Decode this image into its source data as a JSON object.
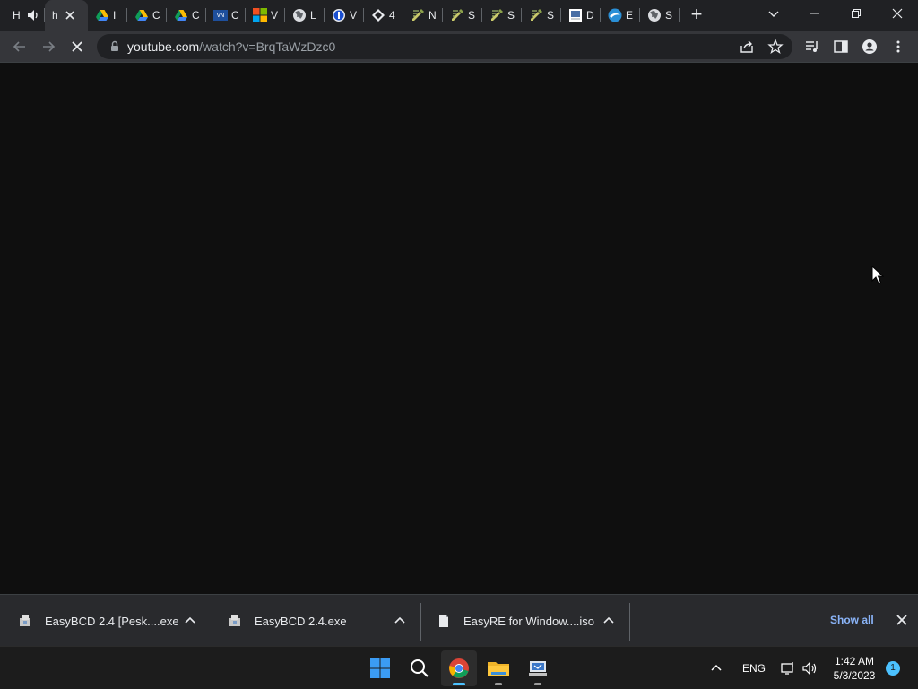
{
  "browser": {
    "tabs": [
      {
        "title": "H",
        "favicon": "text-h",
        "audio": true
      },
      {
        "title": "h",
        "favicon": "text-h-active",
        "active": true
      },
      {
        "title": "I",
        "favicon": "google-drive-icon"
      },
      {
        "title": "C",
        "favicon": "google-drive-icon"
      },
      {
        "title": "C",
        "favicon": "google-drive-icon"
      },
      {
        "title": "C",
        "favicon": "vn-badge-icon"
      },
      {
        "title": "V",
        "favicon": "microsoft-icon"
      },
      {
        "title": "L",
        "favicon": "globe-icon"
      },
      {
        "title": "V",
        "favicon": "blue-circle-icon"
      },
      {
        "title": "4",
        "favicon": "diamond-icon"
      },
      {
        "title": "N",
        "favicon": "edit-icon"
      },
      {
        "title": "S",
        "favicon": "edit-icon"
      },
      {
        "title": "S",
        "favicon": "edit-icon"
      },
      {
        "title": "S",
        "favicon": "edit-icon"
      },
      {
        "title": "D",
        "favicon": "doc-icon"
      },
      {
        "title": "E",
        "favicon": "wave-icon"
      },
      {
        "title": "S",
        "favicon": "globe-icon"
      }
    ],
    "new_tab_label": "+",
    "url_host": "youtube.com",
    "url_path": "/watch?v=BrqTaWzDzc0"
  },
  "downloads": {
    "items": [
      {
        "name": "EasyBCD 2.4 [Pesk....exe"
      },
      {
        "name": "EasyBCD 2.4.exe"
      },
      {
        "name": "EasyRE for Window....iso"
      }
    ],
    "show_all_label": "Show all"
  },
  "taskbar": {
    "language": "ENG",
    "time": "1:42 AM",
    "date": "5/3/2023",
    "notification_count": "1"
  },
  "colors": {
    "tabstrip_bg": "#202124",
    "toolbar_bg": "#35363a",
    "content_bg": "#0f0f0f",
    "link_blue": "#8ab4f8",
    "taskbar_bg": "#1c1c1c",
    "accent": "#4cc2ff"
  }
}
